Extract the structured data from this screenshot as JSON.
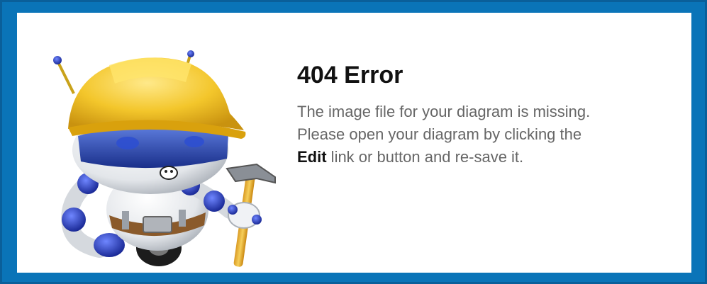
{
  "error": {
    "title": "404 Error",
    "line1": "The image file for your diagram is missing.",
    "line2": "Please open your diagram by clicking the",
    "line3_bold": "Edit",
    "line3_rest": " link or button and re-save it."
  },
  "colors": {
    "frame_border": "#0a74b8",
    "background": "#ffffff",
    "title_text": "#111111",
    "body_text": "#666666"
  },
  "illustration": {
    "icon": "construction-robot-with-hammer-icon"
  }
}
